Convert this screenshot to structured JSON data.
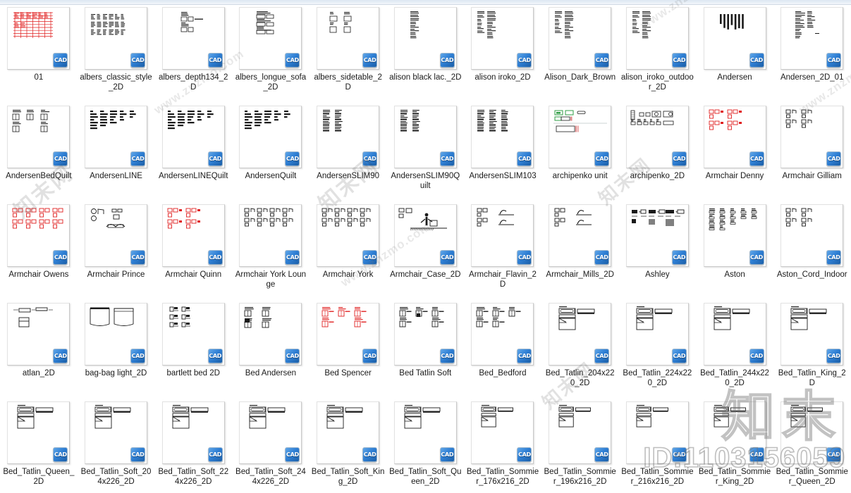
{
  "app": {
    "view": "cad-thumbnail-grid",
    "columns": 11,
    "rows": 5,
    "badge_label": "CAD"
  },
  "watermarks": {
    "site": "www.znzmo.com",
    "brand_cjk": "知末网",
    "brand_large": "知末",
    "id_text": "ID:1103156059"
  },
  "files": [
    {
      "name": "01",
      "art": "redgrid",
      "color": "#e02020"
    },
    {
      "name": "albers_classic_style_2D",
      "art": "blocks",
      "color": "#1a1a1a"
    },
    {
      "name": "albers_depth134_2D",
      "art": "pairs",
      "color": "#1a1a1a"
    },
    {
      "name": "albers_longue_sofa_2D",
      "art": "sofa",
      "color": "#1a1a1a"
    },
    {
      "name": "albers_sidetable_2D",
      "art": "cols2",
      "color": "#1a1a1a"
    },
    {
      "name": "alison black lac._2D",
      "art": "vstack",
      "color": "#1a1a1a"
    },
    {
      "name": "alison iroko_2D",
      "art": "vstack2",
      "color": "#1a1a1a"
    },
    {
      "name": "Alison_Dark_Brown",
      "art": "vstack3",
      "color": "#1a1a1a"
    },
    {
      "name": "alison_iroko_outdoor_2D",
      "art": "vstack2",
      "color": "#1a1a1a"
    },
    {
      "name": "Andersen",
      "art": "bars",
      "color": "#1a1a1a"
    },
    {
      "name": "Andersen_2D_01",
      "art": "vstack4",
      "color": "#1a1a1a"
    },
    {
      "name": "AndersenBedQuilt",
      "art": "beds5",
      "color": "#1a1a1a"
    },
    {
      "name": "AndersenLINE",
      "art": "textcols",
      "color": "#1a1a1a"
    },
    {
      "name": "AndersenLINEQuilt",
      "art": "textcols2",
      "color": "#1a1a1a"
    },
    {
      "name": "AndersenQuilt",
      "art": "textcols3",
      "color": "#1a1a1a"
    },
    {
      "name": "AndersenSLIM90",
      "art": "grid2x4",
      "color": "#1a1a1a"
    },
    {
      "name": "AndersenSLIM90Quilt",
      "art": "grid2x4",
      "color": "#1a1a1a"
    },
    {
      "name": "AndersenSLIM103",
      "art": "grid3x4",
      "color": "#1a1a1a"
    },
    {
      "name": "archipenko unit",
      "art": "greenunits",
      "color": "#2f9e44"
    },
    {
      "name": "archipenko_2D",
      "art": "fixtures",
      "color": "#1a1a1a"
    },
    {
      "name": "Armchair Denny",
      "art": "redchairs",
      "color": "#e02020"
    },
    {
      "name": "Armchair Gilliam",
      "art": "chairs",
      "color": "#1a1a1a"
    },
    {
      "name": "Armchair Owens",
      "art": "redchairs4",
      "color": "#e02020"
    },
    {
      "name": "Armchair Prince",
      "art": "chairsofa",
      "color": "#1a1a1a"
    },
    {
      "name": "Armchair Quinn",
      "art": "redchairs2",
      "color": "#e02020"
    },
    {
      "name": "Armchair York Lounge",
      "art": "chairs4",
      "color": "#1a1a1a"
    },
    {
      "name": "Armchair York",
      "art": "chairs4b",
      "color": "#1a1a1a"
    },
    {
      "name": "Armchair_Case_2D",
      "art": "person",
      "color": "#1a1a1a"
    },
    {
      "name": "Armchair_Flavin_2D",
      "art": "chairside",
      "color": "#1a1a1a"
    },
    {
      "name": "Armchair_Mills_2D",
      "art": "chairside",
      "color": "#1a1a1a"
    },
    {
      "name": "Ashley",
      "art": "sofaplus",
      "color": "#1a1a1a"
    },
    {
      "name": "Aston",
      "art": "manysmall",
      "color": "#1a1a1a"
    },
    {
      "name": "Aston_Cord_Indoor",
      "art": "chairs2x2",
      "color": "#1a1a1a"
    },
    {
      "name": "atlan_2D",
      "art": "atlan",
      "color": "#1a1a1a"
    },
    {
      "name": "bag-bag light_2D",
      "art": "bagbag",
      "color": "#1a1a1a"
    },
    {
      "name": "bartlett bed 2D",
      "art": "bartlett",
      "color": "#1a1a1a"
    },
    {
      "name": "Bed Andersen",
      "art": "bedtable",
      "color": "#1a1a1a"
    },
    {
      "name": "Bed Spencer",
      "art": "redbeds",
      "color": "#e02020"
    },
    {
      "name": "Bed Tatlin Soft",
      "art": "bedset",
      "color": "#1a1a1a"
    },
    {
      "name": "Bed_Bedford",
      "art": "bedset2",
      "color": "#1a1a1a"
    },
    {
      "name": "Bed_Tatlin_204x220_2D",
      "art": "bedplan",
      "color": "#1a1a1a"
    },
    {
      "name": "Bed_Tatlin_224x220_2D",
      "art": "bedplan",
      "color": "#1a1a1a"
    },
    {
      "name": "Bed_Tatlin_244x220_2D",
      "art": "bedplan",
      "color": "#1a1a1a"
    },
    {
      "name": "Bed_Tatlin_King_2D",
      "art": "bedplan",
      "color": "#1a1a1a"
    },
    {
      "name": "Bed_Tatlin_Queen_2D",
      "art": "bedplan",
      "color": "#1a1a1a"
    },
    {
      "name": "Bed_Tatlin_Soft_204x226_2D",
      "art": "bedplan",
      "color": "#1a1a1a"
    },
    {
      "name": "Bed_Tatlin_Soft_224x226_2D",
      "art": "bedplan",
      "color": "#1a1a1a"
    },
    {
      "name": "Bed_Tatlin_Soft_244x226_2D",
      "art": "bedplan",
      "color": "#1a1a1a"
    },
    {
      "name": "Bed_Tatlin_Soft_King_2D",
      "art": "bedplan",
      "color": "#1a1a1a"
    },
    {
      "name": "Bed_Tatlin_Soft_Queen_2D",
      "art": "bedplan",
      "color": "#1a1a1a"
    },
    {
      "name": "Bed_Tatlin_Sommier_176x216_2D",
      "art": "bedplan2",
      "color": "#1a1a1a"
    },
    {
      "name": "Bed_Tatlin_Sommier_196x216_2D",
      "art": "bedplan2",
      "color": "#1a1a1a"
    },
    {
      "name": "Bed_Tatlin_Sommier_216x216_2D",
      "art": "bedplan2",
      "color": "#1a1a1a"
    },
    {
      "name": "Bed_Tatlin_Sommier_King_2D",
      "art": "bedplan2",
      "color": "#1a1a1a"
    },
    {
      "name": "Bed_Tatlin_Sommier_Queen_2D",
      "art": "bedplan2",
      "color": "#1a1a1a"
    }
  ]
}
